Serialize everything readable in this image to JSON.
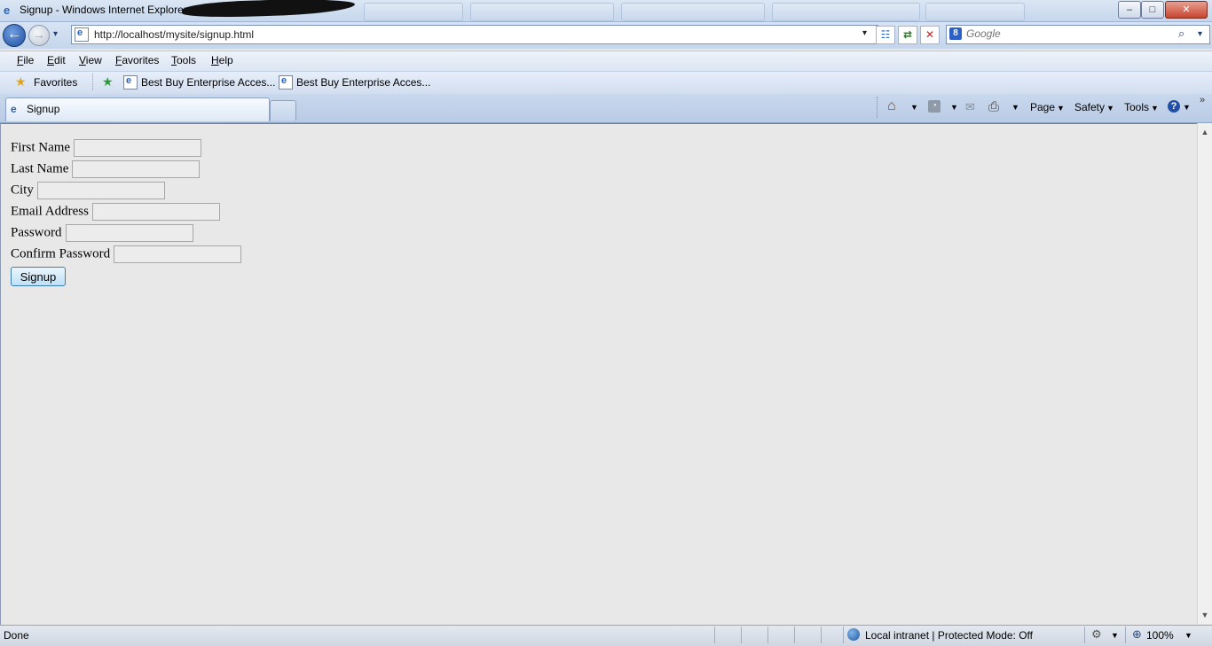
{
  "window": {
    "title": "Signup - Windows Internet Explorer",
    "minimize_glyph": "–",
    "maximize_glyph": "□",
    "close_glyph": "✕"
  },
  "navigation": {
    "back_glyph": "←",
    "forward_glyph": "→",
    "dropdown_glyph": "▾",
    "address": "http://localhost/mysite/signup.html",
    "compat_glyph": "☷",
    "refresh_glyph": "⇄",
    "stop_glyph": "✕",
    "search_placeholder": "Google",
    "search_provider_glyph": "8",
    "search_go_glyph": "⌕"
  },
  "menubar": {
    "items": [
      {
        "key": "F",
        "rest": "ile"
      },
      {
        "key": "E",
        "rest": "dit"
      },
      {
        "key": "V",
        "rest": "iew"
      },
      {
        "key": "F",
        "rest": "avorites"
      },
      {
        "key": "T",
        "rest": "ools"
      },
      {
        "key": "H",
        "rest": "elp"
      }
    ]
  },
  "favorites_bar": {
    "favorites_label": "Favorites",
    "star_glyph": "★",
    "ie_glyph": "e",
    "links": [
      "Best Buy Enterprise Acces...",
      "Best Buy Enterprise Acces..."
    ]
  },
  "tabs": {
    "active_label": "Signup",
    "ie_glyph": "e"
  },
  "command_bar": {
    "home_glyph": "⌂",
    "feeds_glyph": "◔",
    "mail_glyph": "✉",
    "print_glyph": "⎙",
    "help_glyph": "?",
    "dropdown_glyph": "▼",
    "more_glyph": "»",
    "page_label": "Page",
    "safety_label": "Safety",
    "tools_label": "Tools"
  },
  "form": {
    "first_name_label": "First Name",
    "last_name_label": "Last Name",
    "city_label": "City",
    "email_label": "Email Address",
    "password_label": "Password",
    "confirm_password_label": "Confirm Password",
    "first_name_value": "",
    "last_name_value": "",
    "city_value": "",
    "email_value": "",
    "password_value": "",
    "confirm_password_value": "",
    "submit_label": "Signup"
  },
  "scrollbar": {
    "up_glyph": "▲",
    "down_glyph": "▼"
  },
  "statusbar": {
    "status": "Done",
    "zone": "Local intranet | Protected Mode: Off",
    "zoom": "100%",
    "zoom_glyph": "⊕",
    "protect_glyph": "⚙",
    "dropdown_glyph": "▼"
  }
}
